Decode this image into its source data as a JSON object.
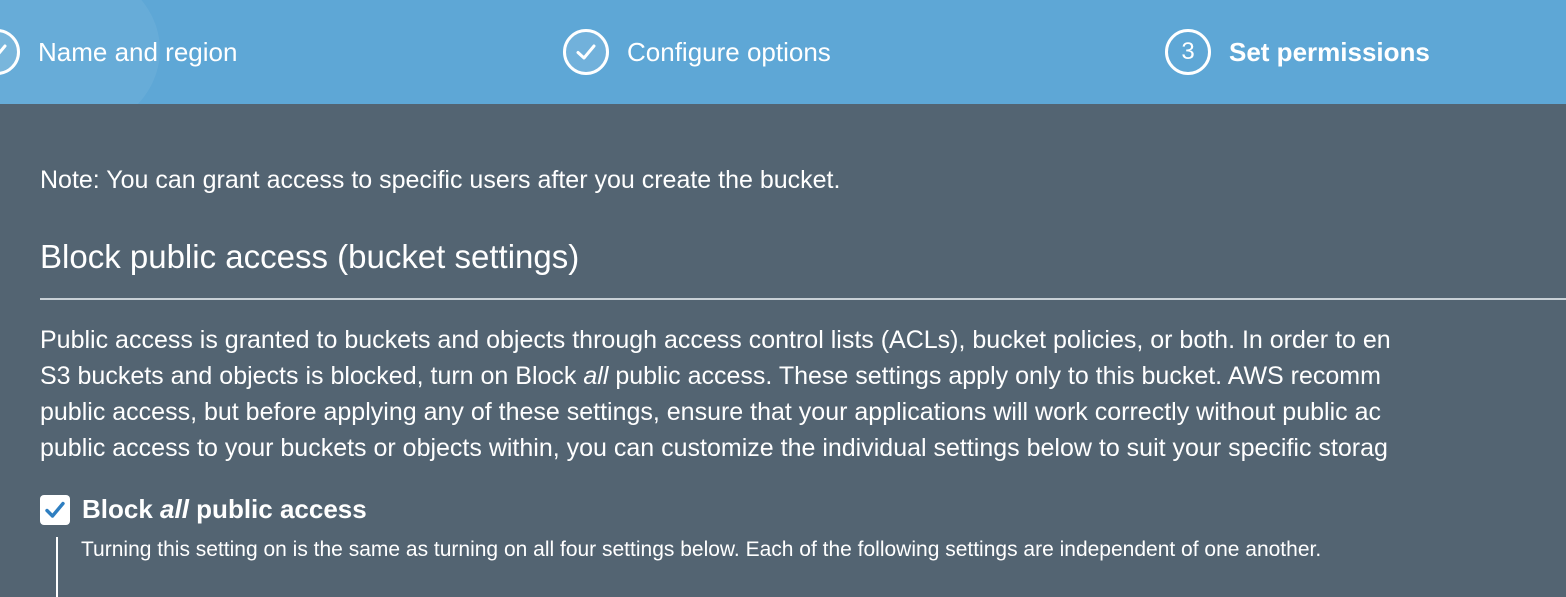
{
  "wizard": {
    "steps": [
      {
        "label": "Name and region",
        "status": "complete"
      },
      {
        "label": "Configure options",
        "status": "complete"
      },
      {
        "label": "Set permissions",
        "status": "current",
        "number": "3"
      }
    ]
  },
  "main": {
    "note": "Note: You can grant access to specific users after you create the bucket.",
    "section_title": "Block public access (bucket settings)",
    "description_lines": [
      "Public access is granted to buckets and objects through access control lists (ACLs), bucket policies, or both. In order to en",
      [
        "S3 buckets and objects is blocked, turn on Block ",
        "all",
        " public access. These settings apply only to this bucket. AWS recomm"
      ],
      "public access, but before applying any of these settings, ensure that your applications will work correctly without public ac",
      "public access to your buckets or objects within, you can customize the individual settings below to suit your specific storag"
    ],
    "block_all": {
      "checked": true,
      "label_prefix": "Block ",
      "label_emphasis": "all",
      "label_suffix": " public access",
      "help_text": "Turning this setting on is the same as turning on all four settings below. Each of the following settings are independent of one another."
    }
  },
  "colors": {
    "wizard_bg": "#5ea7d6",
    "page_bg": "#536472",
    "checkbox_check": "#2f7fc1"
  },
  "icons": {
    "step_complete": "check-circle-icon",
    "checkbox": "checkbox-checked-icon"
  }
}
